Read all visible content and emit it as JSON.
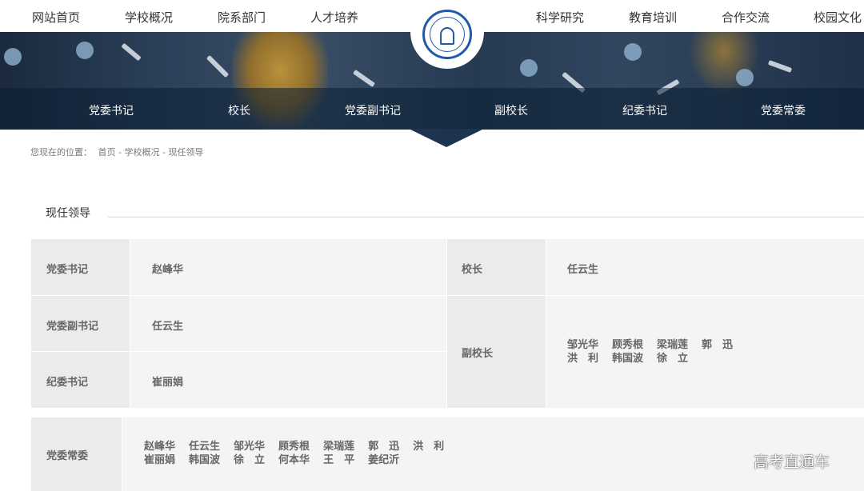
{
  "topnav": {
    "left": [
      "网站首页",
      "学校概况",
      "院系部门",
      "人才培养"
    ],
    "right": [
      "科学研究",
      "教育培训",
      "合作交流",
      "校园文化"
    ]
  },
  "subnav": [
    "党委书记",
    "校长",
    "党委副书记",
    "副校长",
    "纪委书记",
    "党委常委"
  ],
  "breadcrumb": {
    "prefix": "您现在的位置：",
    "path": "首页 - 学校概况 - 现任领导"
  },
  "section": {
    "title": "现任领导"
  },
  "leaders": {
    "secretary": {
      "label": "党委书记",
      "names": [
        "赵峰华"
      ]
    },
    "president": {
      "label": "校长",
      "names": [
        "任云生"
      ]
    },
    "deputy_secretary": {
      "label": "党委副书记",
      "names": [
        "任云生"
      ]
    },
    "vice_presidents": {
      "label": "副校长",
      "rows": [
        [
          "邹光华",
          "顾秀根",
          "梁瑞莲",
          "郭　迅"
        ],
        [
          "洪　利",
          "韩国波",
          "徐　立"
        ]
      ]
    },
    "discipline_secretary": {
      "label": "纪委书记",
      "names": [
        "崔丽娟"
      ]
    },
    "standing_committee": {
      "label": "党委常委",
      "rows": [
        [
          "赵峰华",
          "任云生",
          "邹光华",
          "顾秀根",
          "梁瑞莲",
          "郭　迅",
          "洪　利"
        ],
        [
          "崔丽娟",
          "韩国波",
          "徐　立",
          "何本华",
          "王　平",
          "姜纪沂"
        ]
      ]
    }
  },
  "watermark": "高考直通车",
  "icons": {
    "logo": "university-seal-icon"
  },
  "colors": {
    "banner_shade": "#1d3450",
    "label_bg": "#ebebeb",
    "cell_bg": "#f4f4f4"
  }
}
